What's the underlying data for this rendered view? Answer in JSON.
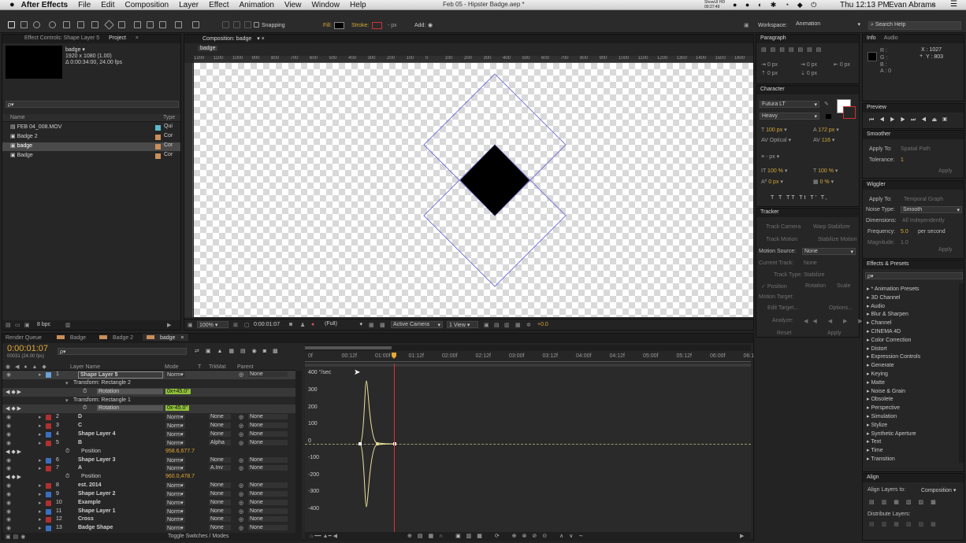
{
  "menubar": {
    "app": "After Effects",
    "items": [
      "File",
      "Edit",
      "Composition",
      "Layer",
      "Effect",
      "Animation",
      "View",
      "Window",
      "Help"
    ],
    "doc_title": "Feb 05 - Hipster Badge.aep *",
    "clock": "Thu 12:13 PM",
    "user": "Evan Abrams",
    "showui": "ShowUI HD",
    "showui_time": "00:27:49"
  },
  "toolbar": {
    "snapping": "Snapping",
    "fill": "Fill:",
    "stroke": "Stroke:",
    "stroke_px": "- px",
    "add": "Add:",
    "workspace_label": "Workspace:",
    "workspace": "Animation",
    "search": "Search Help"
  },
  "project": {
    "tabs": [
      "Effect Controls: Shape Layer 5",
      "Project"
    ],
    "comp_name": "badge ▾",
    "comp_size": "1920 x 1080 (1.00)",
    "comp_duration": "Δ 0:00:34:00, 24.00 fps",
    "search_placeholder": "ρ▾",
    "col_name": "Name",
    "col_type": "Type",
    "items": [
      {
        "name": "FEB 04_008.MOV",
        "type": "Qui"
      },
      {
        "name": "Badge 2",
        "type": "Cor"
      },
      {
        "name": "badge",
        "type": "Cor"
      },
      {
        "name": "Badge",
        "type": "Cor"
      }
    ],
    "bpc": "8 bpc"
  },
  "composition": {
    "tab": "Composition: badge",
    "crumb": "badge",
    "zoom": "100%",
    "timecode": "0:00:01:07",
    "resolution": "(Full)",
    "camera": "Active Camera",
    "view": "1 View",
    "exposure": "+0.0",
    "ruler": [
      "1200",
      "1100",
      "1000",
      "900",
      "800",
      "700",
      "600",
      "500",
      "400",
      "300",
      "200",
      "100",
      "0",
      "100",
      "200",
      "300",
      "400",
      "500",
      "600",
      "700",
      "800",
      "900",
      "1000",
      "1100",
      "1200",
      "1300",
      "1400",
      "1500",
      "1600",
      "1700"
    ]
  },
  "paragraph": {
    "title": "Paragraph",
    "fields": [
      "0 px",
      "0 px",
      "0 px",
      "0 px",
      "0 px"
    ]
  },
  "character": {
    "title": "Character",
    "font": "Futura LT",
    "style": "Heavy",
    "size": "100 px",
    "leading": "172 px",
    "kerning": "Optical",
    "tracking": "116",
    "stroke_w": "- px",
    "vscale": "100 %",
    "hscale": "100 %",
    "baseline": "0 px",
    "tsume": "0 %",
    "styles": [
      "T",
      "T",
      "TT",
      "Tt",
      "T'",
      "T,"
    ]
  },
  "tracker": {
    "title": "Tracker",
    "track_camera": "Track Camera",
    "warp": "Warp Stabilizer",
    "track_motion": "Track Motion",
    "stabilize": "Stabilize Motion",
    "motion_source_label": "Motion Source:",
    "motion_source": "None",
    "current_track_label": "Current Track:",
    "current_track": "None",
    "track_type_label": "Track Type:",
    "track_type": "Stabilize",
    "position": "Position",
    "rotation": "Rotation",
    "scale": "Scale",
    "motion_target": "Motion Target:",
    "edit_target": "Edit Target...",
    "options": "Options...",
    "analyze": "Analyze:",
    "reset": "Reset",
    "apply": "Apply"
  },
  "info": {
    "tabs": [
      "Info",
      "Audio"
    ],
    "r": "R :",
    "g": "G :",
    "b": "B :",
    "a": "A : 0",
    "x": "X : 1027",
    "y": "Y : 803"
  },
  "preview": {
    "title": "Preview"
  },
  "smoother": {
    "title": "Smoother",
    "apply_to_label": "Apply To:",
    "apply_to": "Spatial Path",
    "tolerance_label": "Tolerance:",
    "tolerance": "1",
    "apply": "Apply"
  },
  "wiggler": {
    "title": "Wiggler",
    "apply_to_label": "Apply To:",
    "apply_to": "Temporal Graph",
    "noise_label": "Noise Type:",
    "noise": "Smooth",
    "dims_label": "Dimensions:",
    "dims": "All Independently",
    "freq_label": "Frequency:",
    "freq": "5.0",
    "freq_unit": "per second",
    "mag_label": "Magnitude:",
    "mag": "1.0",
    "apply": "Apply"
  },
  "effects": {
    "title": "Effects & Presets",
    "search": "ρ▾",
    "items": [
      "* Animation Presets",
      "3D Channel",
      "Audio",
      "Blur & Sharpen",
      "Channel",
      "CINEMA 4D",
      "Color Correction",
      "Distort",
      "Expression Controls",
      "Generate",
      "Keying",
      "Matte",
      "Noise & Grain",
      "Obsolete",
      "Perspective",
      "Simulation",
      "Stylize",
      "Synthetic Aperture",
      "Text",
      "Time",
      "Transition"
    ]
  },
  "align": {
    "title": "Align",
    "align_to_label": "Align Layers to:",
    "align_to": "Composition",
    "distribute": "Distribute Layers:"
  },
  "timeline": {
    "tabs": [
      "Render Queue",
      "Badge",
      "Badge 2",
      "badge"
    ],
    "timecode": "0:00:01:07",
    "frame_info": "00031 (24.00 fps)",
    "search": "ρ▾",
    "col_layer": "Layer Name",
    "col_mode": "Mode",
    "col_t": "T",
    "col_trkmat": "TrkMat",
    "col_parent": "Parent",
    "toggle": "Toggle Switches / Modes",
    "ruler": [
      "0f",
      "00:12f",
      "01:00f",
      "01:12f",
      "02:00f",
      "02:12f",
      "03:00f",
      "03:12f",
      "04:00f",
      "04:12f",
      "05:00f",
      "05:12f",
      "06:00f",
      "06:1"
    ],
    "rows": [
      {
        "num": "1",
        "name": "Shape Layer 5",
        "mode": "Norm▾",
        "trk": "",
        "parent": "None",
        "color": "#6aa2d8",
        "kind": "layer",
        "sel": true
      },
      {
        "num": "",
        "name": "Transform: Rectangle 2",
        "kind": "group"
      },
      {
        "num": "",
        "name": "Rotation",
        "value": "0x+45.0°",
        "kind": "prop-box"
      },
      {
        "num": "",
        "name": "Transform: Rectangle 1",
        "kind": "group"
      },
      {
        "num": "",
        "name": "Rotation",
        "value": "0x-45.0°",
        "kind": "prop-box"
      },
      {
        "num": "2",
        "name": "D",
        "mode": "Norm▾",
        "trk": "None",
        "parent": "None",
        "color": "#b03030",
        "kind": "layer"
      },
      {
        "num": "3",
        "name": "C",
        "mode": "Norm▾",
        "trk": "None",
        "parent": "None",
        "color": "#b03030",
        "kind": "layer"
      },
      {
        "num": "4",
        "name": "Shape Layer 4",
        "mode": "Norm▾",
        "trk": "None",
        "parent": "None",
        "color": "#3a6fc0",
        "kind": "layer"
      },
      {
        "num": "5",
        "name": "B",
        "mode": "Norm▾",
        "trk": "Alpha",
        "parent": "None",
        "color": "#b03030",
        "kind": "layer"
      },
      {
        "num": "",
        "name": "Position",
        "value": "958.6,677.7",
        "kind": "prop"
      },
      {
        "num": "6",
        "name": "Shape Layer 3",
        "mode": "Norm▾",
        "trk": "None",
        "parent": "None",
        "color": "#3a6fc0",
        "kind": "layer"
      },
      {
        "num": "7",
        "name": "A",
        "mode": "Norm▾",
        "trk": "A.Inv",
        "parent": "None",
        "color": "#b03030",
        "kind": "layer"
      },
      {
        "num": "",
        "name": "Position",
        "value": "960.0,478.7",
        "kind": "prop"
      },
      {
        "num": "8",
        "name": "est. 2014",
        "mode": "Norm▾",
        "trk": "None",
        "parent": "None",
        "color": "#b03030",
        "kind": "layer"
      },
      {
        "num": "9",
        "name": "Shape Layer 2",
        "mode": "Norm▾",
        "trk": "None",
        "parent": "None",
        "color": "#3a6fc0",
        "kind": "layer"
      },
      {
        "num": "10",
        "name": "Example",
        "mode": "Norm▾",
        "trk": "None",
        "parent": "None",
        "color": "#b03030",
        "kind": "layer"
      },
      {
        "num": "11",
        "name": "Shape Layer 1",
        "mode": "Norm▾",
        "trk": "None",
        "parent": "None",
        "color": "#3a6fc0",
        "kind": "layer"
      },
      {
        "num": "12",
        "name": "Cross",
        "mode": "Norm▾",
        "trk": "None",
        "parent": "None",
        "color": "#b03030",
        "kind": "layer"
      },
      {
        "num": "13",
        "name": "Badge Shape",
        "mode": "Norm▾",
        "trk": "None",
        "parent": "None",
        "color": "#3a6fc0",
        "kind": "layer"
      }
    ],
    "graph_unit": "400 °/sec",
    "graph_ticks": [
      "300",
      "200",
      "100",
      "0",
      "-100",
      "-200",
      "-300",
      "-400"
    ]
  }
}
